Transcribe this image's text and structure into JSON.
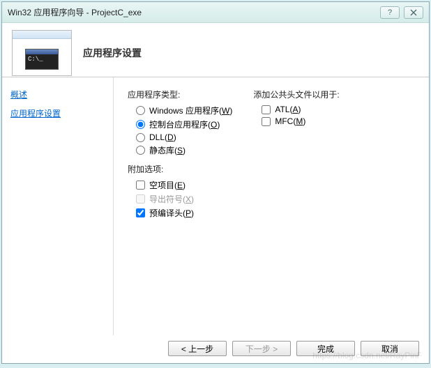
{
  "titlebar": {
    "title": "Win32 应用程序向导 - ProjectC_exe"
  },
  "header": {
    "title": "应用程序设置"
  },
  "sidebar": {
    "items": [
      {
        "label": "概述"
      },
      {
        "label": "应用程序设置"
      }
    ]
  },
  "main": {
    "app_type_label": "应用程序类型:",
    "app_type": {
      "windows": {
        "label": "Windows 应用程序",
        "accel": "W",
        "selected": false
      },
      "console": {
        "label": "控制台应用程序",
        "accel": "O",
        "selected": true
      },
      "dll": {
        "label": "DLL",
        "accel": "D",
        "selected": false
      },
      "static": {
        "label": "静态库",
        "accel": "S",
        "selected": false
      }
    },
    "addl_label": "附加选项:",
    "addl": {
      "empty": {
        "label": "空项目",
        "accel": "E",
        "checked": false,
        "disabled": false
      },
      "export": {
        "label": "导出符号",
        "accel": "X",
        "checked": false,
        "disabled": true
      },
      "pch": {
        "label": "预编译头",
        "accel": "P",
        "checked": true,
        "disabled": false
      }
    },
    "headers_label": "添加公共头文件以用于:",
    "headers": {
      "atl": {
        "label": "ATL",
        "accel": "A",
        "checked": false
      },
      "mfc": {
        "label": "MFC",
        "accel": "M",
        "checked": false
      }
    }
  },
  "footer": {
    "prev": "< 上一步",
    "next": "下一步 >",
    "finish": "完成",
    "cancel": "取消"
  },
  "watermark": "https://blog.csdn.net/RayPinF"
}
